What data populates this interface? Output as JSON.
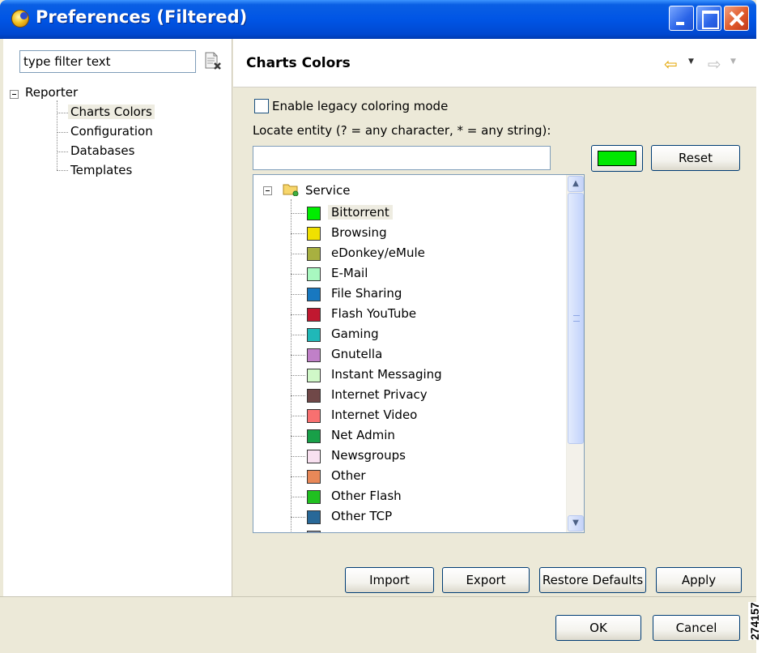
{
  "window": {
    "title": "Preferences (Filtered)"
  },
  "left_pane": {
    "filter_value": "type filter text",
    "tree": {
      "root": "Reporter",
      "children": [
        "Charts Colors",
        "Configuration",
        "Databases",
        "Templates"
      ],
      "selected": "Charts Colors"
    }
  },
  "page": {
    "title": "Charts Colors",
    "legacy_checkbox": {
      "label": "Enable legacy coloring mode",
      "checked": false
    },
    "locate_label": "Locate entity (? = any character, * = any string):",
    "locate_value": "",
    "current_color": "#00e800",
    "reset_label": "Reset",
    "service_tree": {
      "root": "Service",
      "items": [
        {
          "label": "Bittorrent",
          "color": "#00ee00"
        },
        {
          "label": "Browsing",
          "color": "#f0e000"
        },
        {
          "label": "eDonkey/eMule",
          "color": "#a8b040"
        },
        {
          "label": "E-Mail",
          "color": "#a8f8c0"
        },
        {
          "label": "File Sharing",
          "color": "#1878c0"
        },
        {
          "label": "Flash YouTube",
          "color": "#c01830"
        },
        {
          "label": "Gaming",
          "color": "#20b8b8"
        },
        {
          "label": "Gnutella",
          "color": "#c080c8"
        },
        {
          "label": "Instant Messaging",
          "color": "#d0f8c8"
        },
        {
          "label": "Internet Privacy",
          "color": "#704848"
        },
        {
          "label": "Internet Video",
          "color": "#f87070"
        },
        {
          "label": "Net Admin",
          "color": "#18a048"
        },
        {
          "label": "Newsgroups",
          "color": "#f8e0f0"
        },
        {
          "label": "Other",
          "color": "#e88858"
        },
        {
          "label": "Other Flash",
          "color": "#20c020"
        },
        {
          "label": "Other TCP",
          "color": "#286898"
        },
        {
          "label": "",
          "color": "#8890a8"
        }
      ],
      "selected": "Bittorrent"
    },
    "buttons": {
      "import": "Import",
      "export": "Export",
      "restore_defaults": "Restore Defaults",
      "apply": "Apply"
    }
  },
  "footer": {
    "ok": "OK",
    "cancel": "Cancel"
  },
  "figure_id": "274157"
}
